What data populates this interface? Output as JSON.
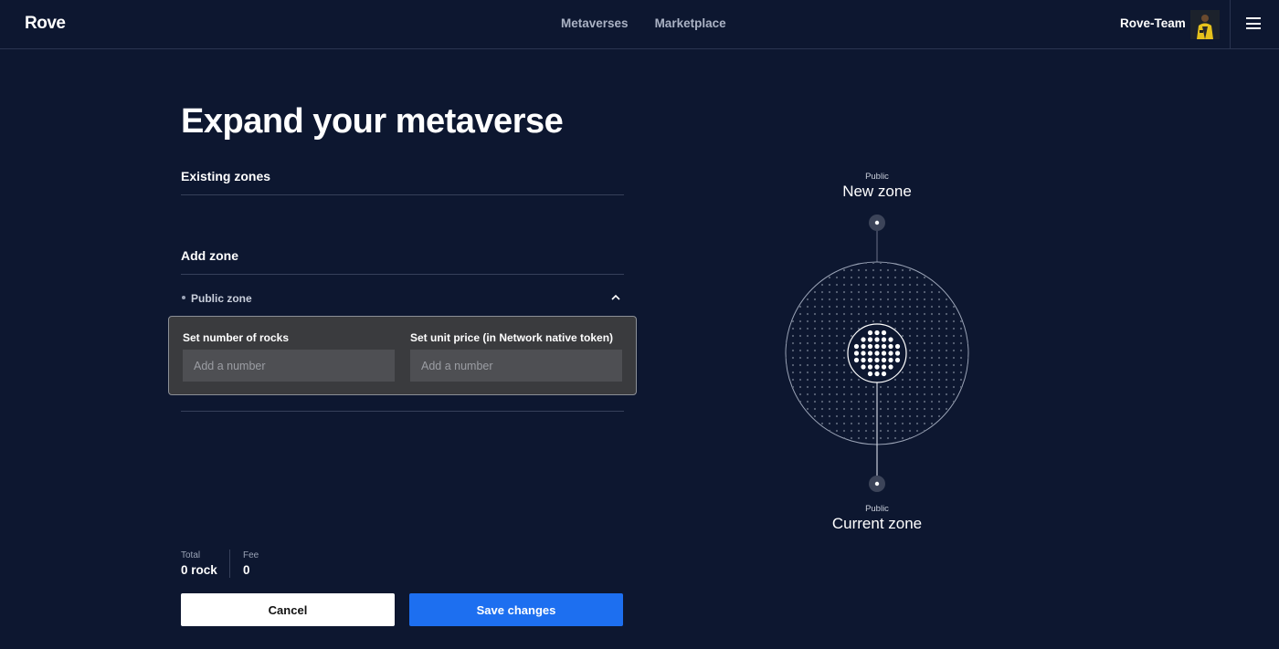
{
  "header": {
    "logo": "Rove",
    "nav": [
      "Metaverses",
      "Marketplace"
    ],
    "username": "Rove-Team"
  },
  "main": {
    "title": "Expand your metaverse",
    "existing_zones_label": "Existing zones",
    "add_zone_label": "Add zone",
    "zone": {
      "name": "Public zone",
      "rocks_label": "Set number of rocks",
      "rocks_placeholder": "Add a number",
      "price_label": "Set unit price (in Network native token)",
      "price_placeholder": "Add a number"
    },
    "summary": {
      "total_label": "Total",
      "total_value": "0 rock",
      "fee_label": "Fee",
      "fee_value": "0"
    },
    "cancel_label": "Cancel",
    "save_label": "Save changes"
  },
  "diagram": {
    "new_zone_type": "Public",
    "new_zone_label": "New zone",
    "current_zone_type": "Public",
    "current_zone_label": "Current zone"
  },
  "colors": {
    "background": "#0d1730",
    "accent": "#1d6ff0",
    "panel": "#3a3b3e"
  }
}
